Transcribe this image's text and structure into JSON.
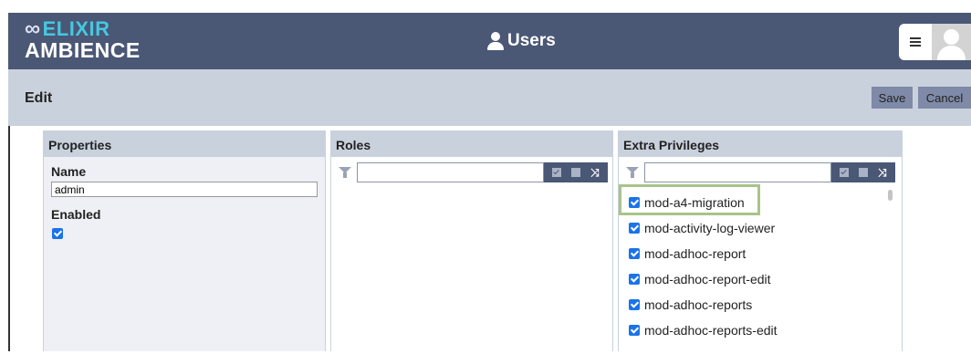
{
  "header": {
    "logo_line1": "ELIXIR",
    "logo_line2": "AMBIENCE",
    "logo_symbol": "∞",
    "title": "Users",
    "menu_icon": "hamburger-icon",
    "avatar_icon": "user-avatar-icon",
    "bg_color": "#4a5775"
  },
  "editbar": {
    "title": "Edit",
    "save_label": "Save",
    "cancel_label": "Cancel"
  },
  "properties": {
    "heading": "Properties",
    "name_label": "Name",
    "name_value": "admin",
    "enabled_label": "Enabled",
    "enabled_checked": true
  },
  "roles": {
    "heading": "Roles",
    "filter_value": ""
  },
  "privileges": {
    "heading": "Extra Privileges",
    "filter_value": "",
    "items": [
      {
        "label": "mod-a4-migration",
        "checked": true
      },
      {
        "label": "mod-activity-log-viewer",
        "checked": true
      },
      {
        "label": "mod-adhoc-report",
        "checked": true
      },
      {
        "label": "mod-adhoc-report-edit",
        "checked": true
      },
      {
        "label": "mod-adhoc-reports",
        "checked": true
      },
      {
        "label": "mod-adhoc-reports-edit",
        "checked": true
      }
    ]
  },
  "colors": {
    "header": "#4a5775",
    "editbar": "#c9d1dd",
    "button": "#7f8aa8",
    "accent": "#45c8e0",
    "checkbox": "#1a73e8",
    "highlight": "#a8c48a"
  }
}
